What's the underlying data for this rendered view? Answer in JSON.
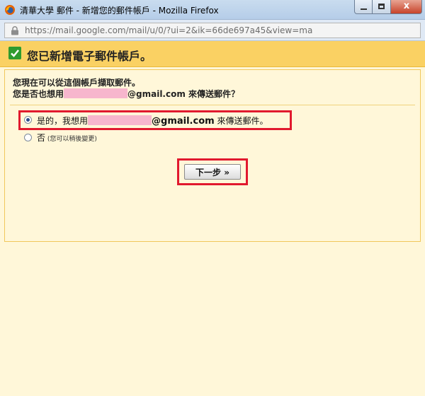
{
  "window": {
    "title": "清華大學 郵件 - 新增您的郵件帳戶 - Mozilla Firefox",
    "minimize_icon": "minimize-icon",
    "maximize_icon": "maximize-icon",
    "close_label": "x"
  },
  "urlbar": {
    "url": "https://mail.google.com/mail/u/0/?ui=2&ik=66de697a45&view=ma",
    "icon": "lock-icon"
  },
  "header": {
    "title": "您已新增電子郵件帳戶。",
    "icon": "check-icon",
    "icon_color": "#2f9b2f",
    "bg_color": "#fad163"
  },
  "body": {
    "line1": "您現在可以從這個帳戶擷取郵件。",
    "line2_prefix": "您是否也想用",
    "line2_email_suffix": "@gmail.com",
    "line2_suffix": " 來傳送郵件？"
  },
  "options": {
    "yes_prefix": "是的，我想用",
    "yes_email_suffix": "@gmail.com",
    "yes_suffix": " 來傳送郵件。",
    "yes_selected": true,
    "no_label": "否",
    "no_hint": " (您可以稍後變更)"
  },
  "actions": {
    "next_label": "下一步 »"
  },
  "colors": {
    "highlight": "#e1192e",
    "page_bg": "#fff7d9",
    "redaction": "#f7b6cd"
  }
}
